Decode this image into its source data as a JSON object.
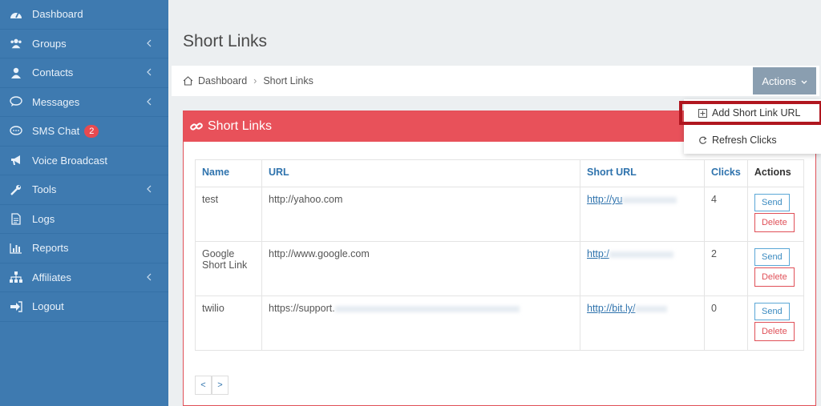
{
  "sidebar": {
    "items": [
      {
        "label": "Dashboard",
        "icon": "dashboard-icon",
        "chevron": false
      },
      {
        "label": "Groups",
        "icon": "users-icon",
        "chevron": true
      },
      {
        "label": "Contacts",
        "icon": "user-icon",
        "chevron": true
      },
      {
        "label": "Messages",
        "icon": "message-icon",
        "chevron": true
      },
      {
        "label": "SMS Chat",
        "icon": "chat-icon",
        "chevron": false,
        "badge": "2"
      },
      {
        "label": "Voice Broadcast",
        "icon": "megaphone-icon",
        "chevron": false
      },
      {
        "label": "Tools",
        "icon": "wrench-icon",
        "chevron": true
      },
      {
        "label": "Logs",
        "icon": "document-icon",
        "chevron": false
      },
      {
        "label": "Reports",
        "icon": "bar-chart-icon",
        "chevron": false
      },
      {
        "label": "Affiliates",
        "icon": "sitemap-icon",
        "chevron": true
      },
      {
        "label": "Logout",
        "icon": "logout-icon",
        "chevron": false
      }
    ]
  },
  "page": {
    "title": "Short Links"
  },
  "breadcrumb": {
    "home": "Dashboard",
    "current": "Short Links"
  },
  "actions": {
    "label": "Actions"
  },
  "dropdown": {
    "add": "Add Short Link URL",
    "refresh": "Refresh Clicks"
  },
  "panel": {
    "title": "Short Links"
  },
  "table": {
    "headers": [
      "Name",
      "URL",
      "Short URL",
      "Clicks",
      "Actions"
    ],
    "rows": [
      {
        "name": "test",
        "url": "http://yahoo.com",
        "short": "http://yu",
        "clicks": "4",
        "send": "Send",
        "delete": "Delete"
      },
      {
        "name": "Google Short Link",
        "url": "http://www.google.com",
        "short": "http:/",
        "clicks": "2",
        "send": "Send",
        "delete": "Delete"
      },
      {
        "name": "twilio",
        "url": "https://support.",
        "short": "http://bit.ly/",
        "clicks": "0",
        "send": "Send",
        "delete": "Delete"
      }
    ]
  },
  "pager": {
    "prev": "<",
    "next": ">"
  },
  "colors": {
    "sidebar": "#3e7ab0",
    "accent": "#e8515a",
    "link": "#2f73ad",
    "highlight": "#b0161f"
  }
}
